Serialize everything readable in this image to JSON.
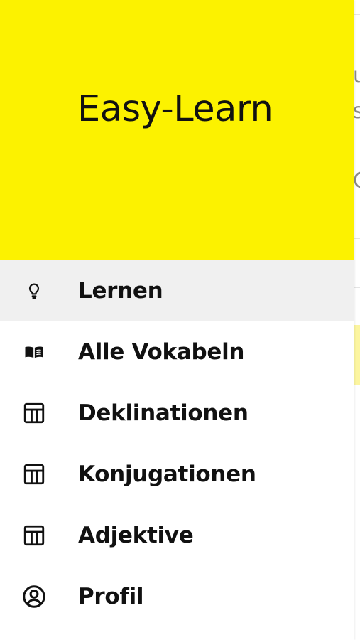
{
  "app": {
    "title": "Easy-Learn",
    "header_color": "#fcf200"
  },
  "menu": {
    "items": [
      {
        "label": "Lernen",
        "icon": "lightbulb-icon",
        "active": true
      },
      {
        "label": "Alle Vokabeln",
        "icon": "book-icon",
        "active": false
      },
      {
        "label": "Deklinationen",
        "icon": "table-icon",
        "active": false
      },
      {
        "label": "Konjugationen",
        "icon": "table-icon",
        "active": false
      },
      {
        "label": "Adjektive",
        "icon": "table-icon",
        "active": false
      },
      {
        "label": "Profil",
        "icon": "profile-icon",
        "active": false
      }
    ]
  },
  "background_page": {
    "fragments": [
      "u",
      "s",
      "C"
    ]
  }
}
